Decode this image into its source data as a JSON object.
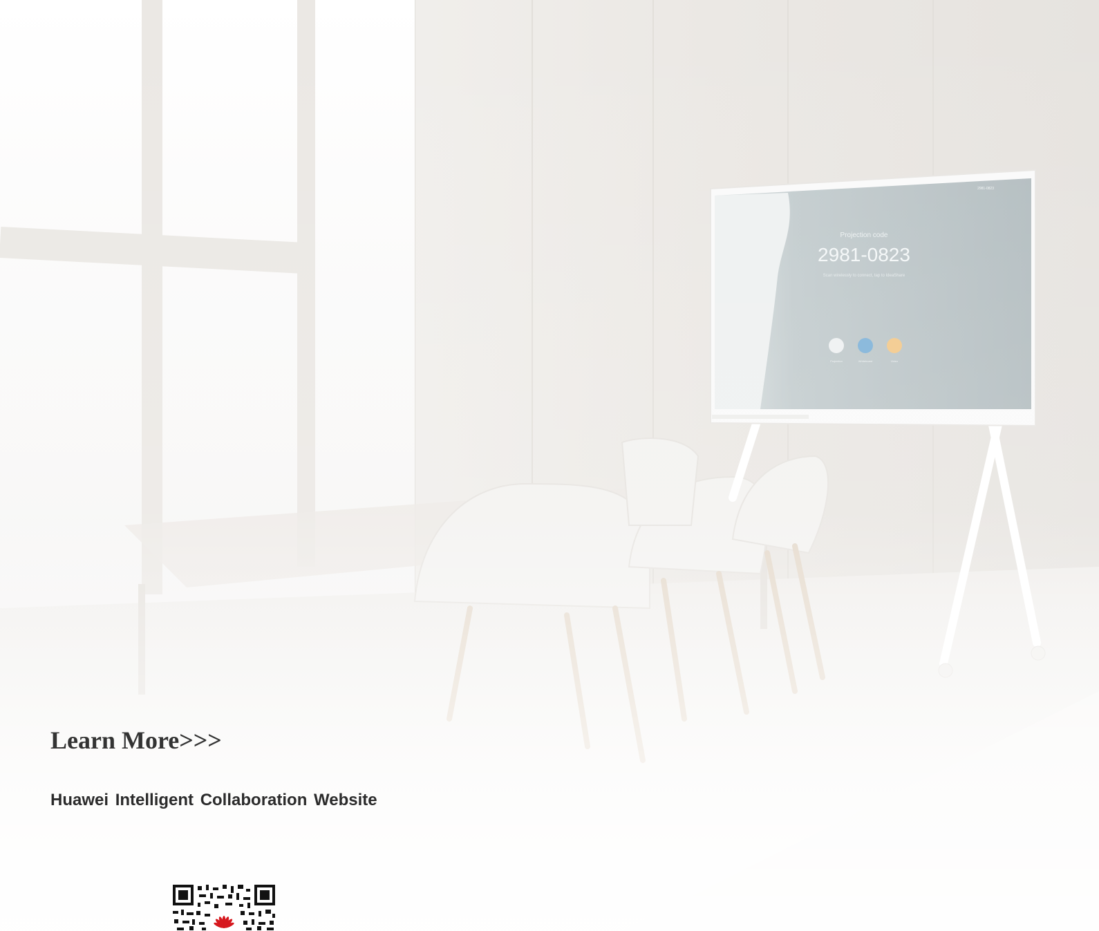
{
  "screen": {
    "board_number": "2981-0823",
    "board_caption": "Projection code",
    "board_subcaption": "Scan wirelessly to connect, tap to IdeaShare",
    "app_labels": [
      "Projection",
      "Whiteboard",
      "Video"
    ],
    "status_text": "2981-0823"
  },
  "cta": {
    "learn_more": "Learn More>>>",
    "website_label": "Huawei Intelligent Collaboration Website"
  },
  "qr": {
    "icon": "qr-code-icon",
    "logo_icon": "huawei-logo-icon",
    "logo_color": "#d6191f"
  },
  "colors": {
    "heading": "#333333",
    "text": "#2b2b2b",
    "wall": "#e9e6e2",
    "screen_glass": "#b8c3c5"
  }
}
